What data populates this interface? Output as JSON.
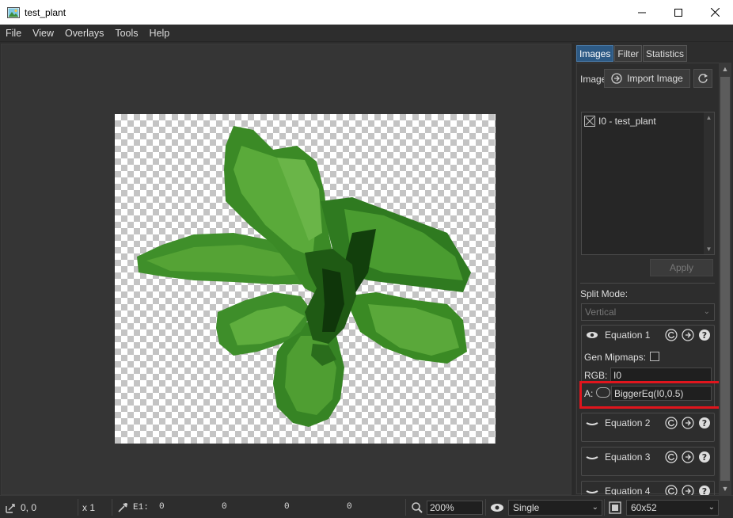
{
  "window": {
    "title": "test_plant",
    "minimize_label": "—",
    "maximize_label": "☐",
    "close_label": "✕"
  },
  "menu": [
    "File",
    "View",
    "Overlays",
    "Tools",
    "Help"
  ],
  "panel": {
    "tabs": [
      "Images",
      "Filter",
      "Statistics"
    ],
    "active_tab": "Images",
    "images_label": "Image",
    "import_button": "Import Image",
    "image_list": [
      {
        "label": "I0 - test_plant"
      }
    ],
    "apply_button": "Apply",
    "split_mode_label": "Split Mode:",
    "split_mode_value": "Vertical",
    "equations": [
      {
        "name": "Equation 1",
        "expanded": true,
        "visible": true,
        "gen_mipmaps_label": "Gen Mipmaps:",
        "rgb_label": "RGB:",
        "rgb_value": "I0",
        "a_label": "A:",
        "a_value": "BiggerEq(I0,0.5)"
      },
      {
        "name": "Equation 2",
        "expanded": false,
        "visible": false
      },
      {
        "name": "Equation 3",
        "expanded": false,
        "visible": false
      },
      {
        "name": "Equation 4",
        "expanded": false,
        "visible": false
      }
    ]
  },
  "statusbar": {
    "coords": "0, 0",
    "zoom_factor": "x 1",
    "eq_label": "E1:",
    "eq_values": [
      "0",
      "0",
      "0",
      "0"
    ],
    "zoom_value": "200%",
    "display_mode": "Single",
    "image_size": "60x52"
  },
  "colors": {
    "accent_tab": "#2d5a85",
    "highlight": "#e0151d",
    "leaf_dark": "#1f5a14",
    "leaf_light": "#5ea838"
  }
}
